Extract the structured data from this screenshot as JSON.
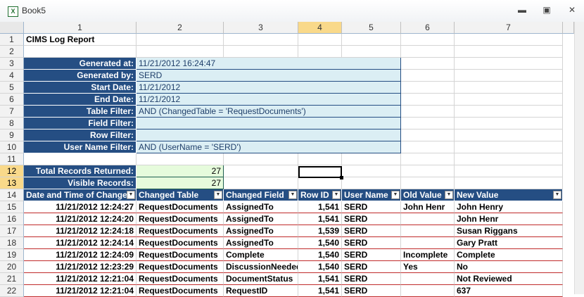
{
  "window": {
    "title": "Book5",
    "icon": "excel-icon"
  },
  "column_headers": [
    "1",
    "2",
    "3",
    "4",
    "5",
    "6",
    "7"
  ],
  "row_numbers": [
    "1",
    "2",
    "3",
    "4",
    "5",
    "6",
    "7",
    "8",
    "9",
    "10",
    "11",
    "12",
    "13",
    "14",
    "15",
    "16",
    "17",
    "18",
    "19",
    "20",
    "21",
    "22"
  ],
  "report": {
    "title": "CIMS Log Report",
    "fields": [
      {
        "label": "Generated at:",
        "value": "11/21/2012 16:24:47"
      },
      {
        "label": "Generated by:",
        "value": "SERD"
      },
      {
        "label": "Start Date:",
        "value": "11/21/2012"
      },
      {
        "label": "End Date:",
        "value": "11/21/2012"
      },
      {
        "label": "Table Filter:",
        "value": " AND (ChangedTable = 'RequestDocuments')"
      },
      {
        "label": "Field Filter:",
        "value": ""
      },
      {
        "label": "Row Filter:",
        "value": ""
      },
      {
        "label": "User Name Filter:",
        "value": " AND (UserName = 'SERD')"
      }
    ],
    "totals": [
      {
        "label": "Total Records Returned:",
        "value": "27"
      },
      {
        "label": "Visible Records:",
        "value": "27"
      }
    ]
  },
  "table": {
    "headers": [
      "Date and Time of Change",
      "Changed Table",
      "Changed Field",
      "Row ID",
      "User Name",
      "Old Value",
      "New Value"
    ],
    "rows": [
      [
        "11/21/2012 12:24:27",
        "RequestDocuments",
        "AssignedTo",
        "1,541",
        "SERD",
        "John Henr",
        "John Henry"
      ],
      [
        "11/21/2012 12:24:20",
        "RequestDocuments",
        "AssignedTo",
        "1,541",
        "SERD",
        "",
        "John Henr"
      ],
      [
        "11/21/2012 12:24:18",
        "RequestDocuments",
        "AssignedTo",
        "1,539",
        "SERD",
        "",
        "Susan Riggans"
      ],
      [
        "11/21/2012 12:24:14",
        "RequestDocuments",
        "AssignedTo",
        "1,540",
        "SERD",
        "",
        "Gary Pratt"
      ],
      [
        "11/21/2012 12:24:09",
        "RequestDocuments",
        "Complete",
        "1,540",
        "SERD",
        "Incomplete",
        "Complete"
      ],
      [
        "11/21/2012 12:23:29",
        "RequestDocuments",
        "DiscussionNeeded",
        "1,540",
        "SERD",
        "Yes",
        "No"
      ],
      [
        "11/21/2012 12:21:04",
        "RequestDocuments",
        "DocumentStatus",
        "1,541",
        "SERD",
        "",
        "Not Reviewed"
      ],
      [
        "11/21/2012 12:21:04",
        "RequestDocuments",
        "RequestID",
        "1,541",
        "SERD",
        "",
        "637"
      ]
    ]
  },
  "colors": {
    "navy": "#254e83",
    "light_blue": "#dbeef4",
    "light_green": "#e6fbdc",
    "row_border": "#c02b2b",
    "selection_header": "#f9d98a"
  }
}
